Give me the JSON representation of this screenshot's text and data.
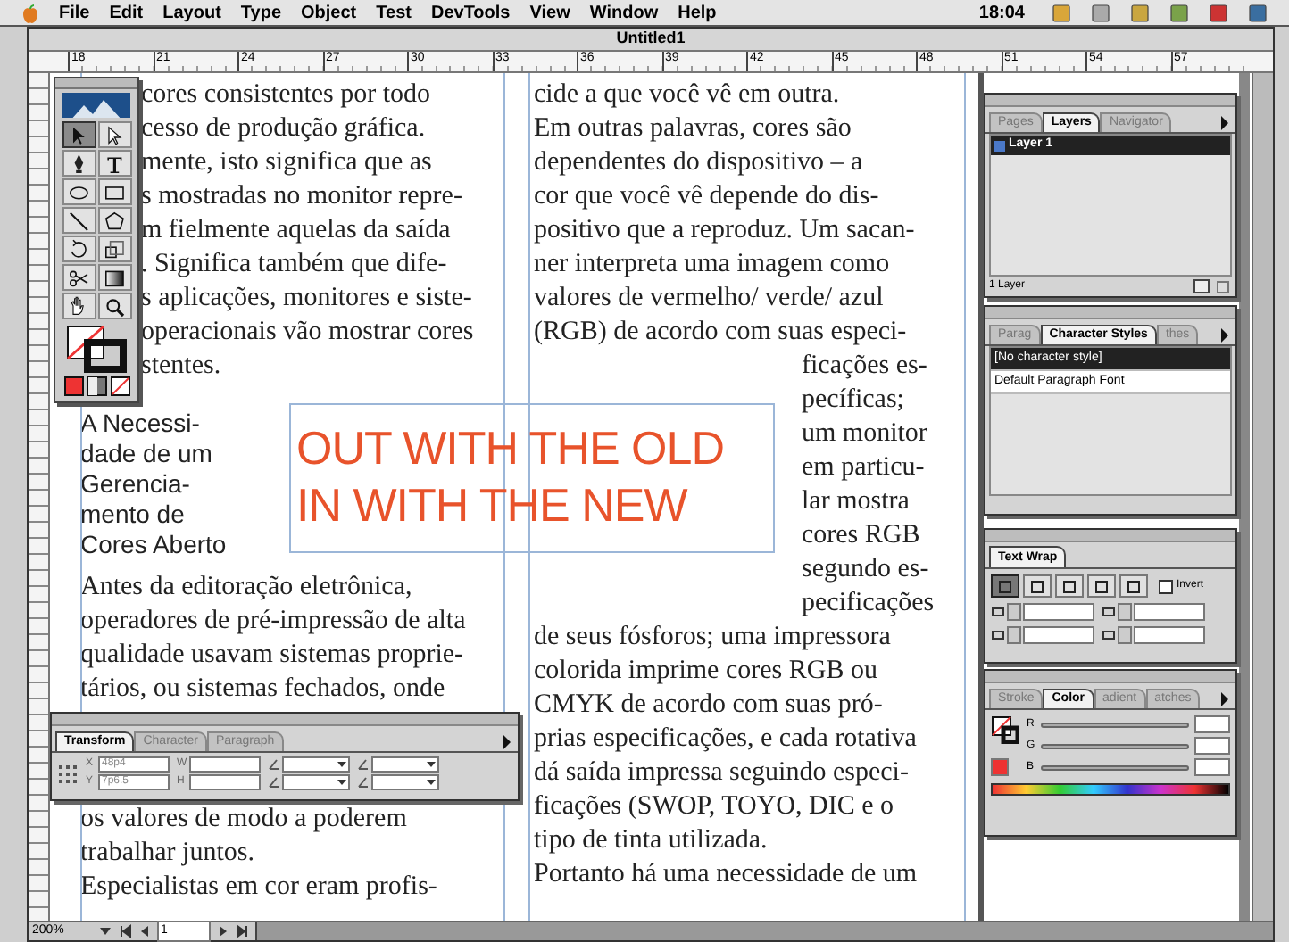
{
  "menu_bar": {
    "items": [
      "File",
      "Edit",
      "Layout",
      "Type",
      "Object",
      "Test",
      "DevTools",
      "View",
      "Window",
      "Help"
    ],
    "clock": "18:04"
  },
  "window": {
    "title": "Untitled1"
  },
  "ruler": {
    "marks": [
      "18",
      "21",
      "24",
      "27",
      "30",
      "33",
      "36",
      "39",
      "42",
      "45",
      "48",
      "51",
      "54",
      "57"
    ]
  },
  "tools": [
    {
      "kind": "selection",
      "selected": true
    },
    {
      "kind": "direct",
      "selected": false
    },
    {
      "kind": "pen",
      "selected": false
    },
    {
      "kind": "type",
      "selected": false
    },
    {
      "kind": "ellipse",
      "selected": false
    },
    {
      "kind": "rectangle",
      "selected": false
    },
    {
      "kind": "line",
      "selected": false
    },
    {
      "kind": "polygon",
      "selected": false
    },
    {
      "kind": "rotate",
      "selected": false
    },
    {
      "kind": "scale",
      "selected": false
    },
    {
      "kind": "scissors",
      "selected": false
    },
    {
      "kind": "gradient",
      "selected": false
    },
    {
      "kind": "hand",
      "selected": false
    },
    {
      "kind": "zoom",
      "selected": false
    }
  ],
  "columns": [
    {
      "blocks": [
        {
          "kind": "body-behind-toolbox",
          "lines": [
            "cores consistentes  por todo",
            "cesso de produção gráfica.",
            "mente, isto significa que as",
            "s mostradas no monitor repre-",
            "m fielmente aquelas da saída",
            ". Significa também que dife-",
            "s aplicações, monitores e siste-",
            "operacionais vão mostrar cores",
            "stentes."
          ]
        },
        {
          "kind": "heading",
          "lines": [
            "A Necessi-",
            "dade de um",
            "Gerencia-",
            "mento de",
            "Cores Aberto"
          ]
        },
        {
          "kind": "body",
          "lines": [
            "Antes da editoração eletrônica,",
            "operadores de pré-impressão de alta",
            "qualidade usavam sistemas proprie-",
            "tários, ou sistemas fechados, onde"
          ]
        },
        {
          "kind": "body-below-panel",
          "lines": [
            "os valores de modo a poderem",
            "trabalhar juntos.",
            "Especialistas em cor eram profis-"
          ]
        }
      ]
    },
    {
      "blocks": [
        {
          "kind": "body",
          "lines": [
            "cide a que você vê em outra.",
            "Em outras palavras, cores são",
            "dependentes do dispositivo – a",
            "cor que você vê depende do dis-",
            "positivo que a reproduz. Um sacan-",
            "ner interpreta uma imagem como",
            "valores de vermelho/ verde/ azul",
            "(RGB) de acordo com suas especi-"
          ]
        },
        {
          "kind": "body-wrapped",
          "lines": [
            "ficações es-",
            "pecíficas;",
            "um monitor",
            "em particu-",
            "lar mostra",
            "cores RGB",
            "segundo es-",
            "pecificações"
          ]
        },
        {
          "kind": "body",
          "lines": [
            "de seus fósforos; uma impressora",
            "colorida imprime cores RGB ou",
            "CMYK de acordo com suas pró-",
            "prias especificações, e cada rotativa",
            "dá saída impressa seguindo especi-",
            "ficações (SWOP, TOYO, DIC  e o",
            "tipo de tinta utilizada.",
            "Portanto há uma necessidade de um"
          ]
        }
      ]
    }
  ],
  "frame": {
    "lines": [
      "OUT WITH THE OLD",
      "IN WITH THE NEW"
    ]
  },
  "transform_panel": {
    "tabs": [
      {
        "label": "Transform",
        "selected": true
      },
      {
        "label": "Character",
        "selected": false
      },
      {
        "label": "Paragraph",
        "selected": false
      }
    ],
    "fields": [
      {
        "label": "X",
        "value": "48p4"
      },
      {
        "label": "Y",
        "value": "7p6.5"
      },
      {
        "label": "W"
      },
      {
        "label": "H"
      }
    ]
  },
  "layers_panel": {
    "tabs": [
      {
        "label": "Pages",
        "selected": false
      },
      {
        "label": "Layers",
        "selected": true
      },
      {
        "label": "Navigator",
        "selected": false
      }
    ],
    "layers": [
      {
        "name": "Layer 1",
        "selected": true
      }
    ],
    "footer": "1 Layer"
  },
  "character_styles_panel": {
    "tabs": [
      {
        "label": "Parag",
        "selected": false
      },
      {
        "label": "Character Styles",
        "selected": true
      },
      {
        "label": "thes",
        "selected": false
      }
    ],
    "styles": [
      {
        "name": "[No character style]",
        "selected": true
      },
      {
        "name": "Default Paragraph Font",
        "selected": false
      }
    ]
  },
  "text_wrap_panel": {
    "tab": "Text Wrap",
    "options": [
      {
        "selected": true
      },
      {
        "selected": false
      },
      {
        "selected": false
      },
      {
        "selected": false
      },
      {
        "selected": false
      }
    ],
    "invert": {
      "label": "Invert",
      "checked": false
    }
  },
  "color_panel": {
    "tabs": [
      {
        "label": "Stroke",
        "selected": false
      },
      {
        "label": "Color",
        "selected": true
      },
      {
        "label": "adient",
        "selected": false
      },
      {
        "label": "atches",
        "selected": false
      }
    ],
    "channels": [
      "R",
      "G",
      "B"
    ]
  },
  "status_bar": {
    "zoom": "200%",
    "page": "1"
  }
}
